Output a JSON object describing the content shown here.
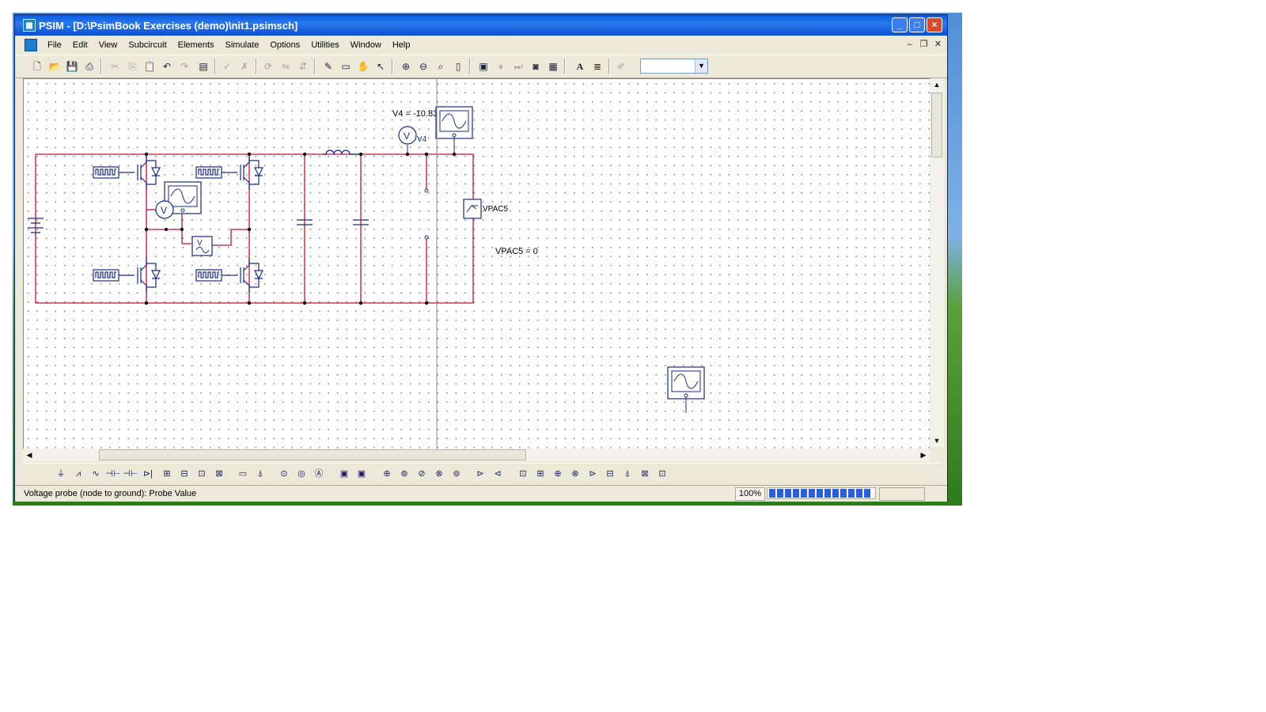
{
  "window": {
    "title": "PSIM - [D:\\PsimBook Exercises (demo)\\nit1.psimsch]",
    "app_icon": "psim-app-icon"
  },
  "menu": [
    "File",
    "Edit",
    "View",
    "Subcircuit",
    "Elements",
    "Simulate",
    "Options",
    "Utilities",
    "Window",
    "Help"
  ],
  "schematic": {
    "labels": {
      "v4_value": "V4 = -10.8327",
      "v4_name": "V4",
      "vpac_name": "VPAC5",
      "vpac_value": "VPAC5 = 0",
      "voltmeter_symbol": "V"
    },
    "colors": {
      "wire": "#c8102e",
      "component": "#1a2a8a",
      "grid_dot": "#7a7a7a"
    }
  },
  "status": {
    "text": "Voltage probe (node to ground): Probe Value",
    "zoom": "100%",
    "progress_percent": 100
  }
}
